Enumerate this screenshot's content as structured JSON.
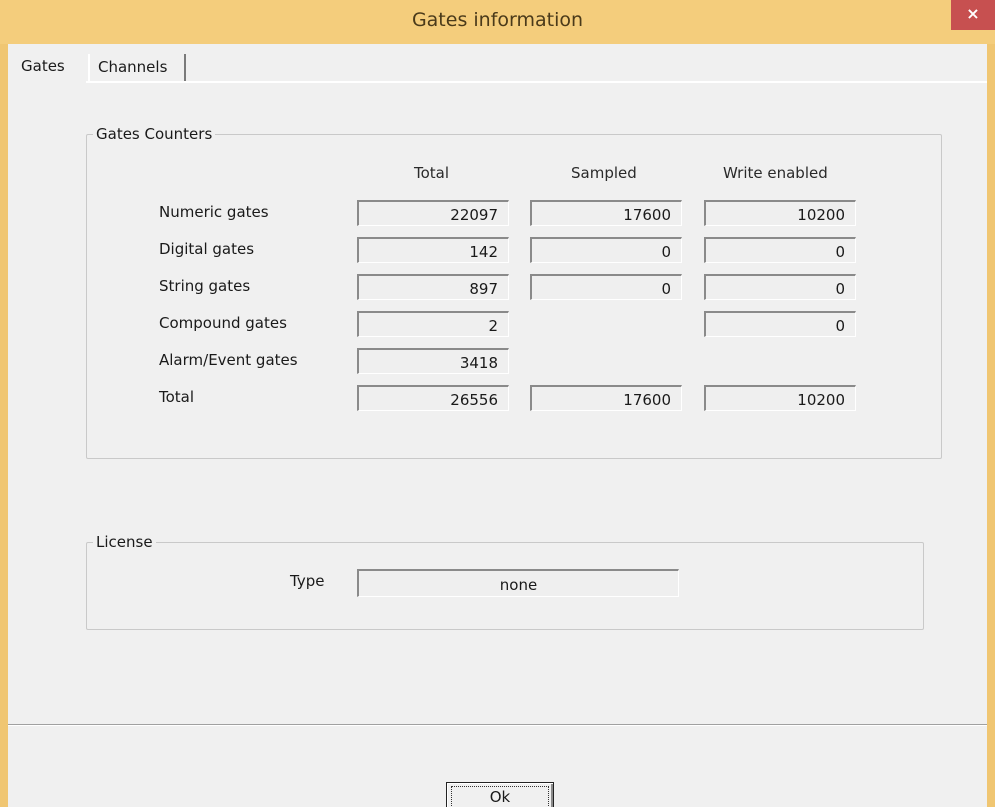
{
  "window": {
    "title": "Gates information",
    "close_glyph": "×"
  },
  "tabs": [
    {
      "label": "Gates",
      "active": true
    },
    {
      "label": "Channels",
      "active": false
    }
  ],
  "counters": {
    "legend": "Gates Counters",
    "columns": {
      "total": "Total",
      "sampled": "Sampled",
      "write_enabled": "Write enabled"
    },
    "rows": [
      {
        "label": "Numeric gates",
        "total": "22097",
        "sampled": "17600",
        "write_enabled": "10200"
      },
      {
        "label": "Digital gates",
        "total": "142",
        "sampled": "0",
        "write_enabled": "0"
      },
      {
        "label": "String gates",
        "total": "897",
        "sampled": "0",
        "write_enabled": "0"
      },
      {
        "label": "Compound gates",
        "total": "2",
        "write_enabled": "0"
      },
      {
        "label": "Alarm/Event gates",
        "total": "3418"
      },
      {
        "label": "Total",
        "total": "26556",
        "sampled": "17600",
        "write_enabled": "10200"
      }
    ]
  },
  "license": {
    "legend": "License",
    "type_label": "Type",
    "type_value": "none"
  },
  "footer": {
    "ok_label": "Ok"
  }
}
